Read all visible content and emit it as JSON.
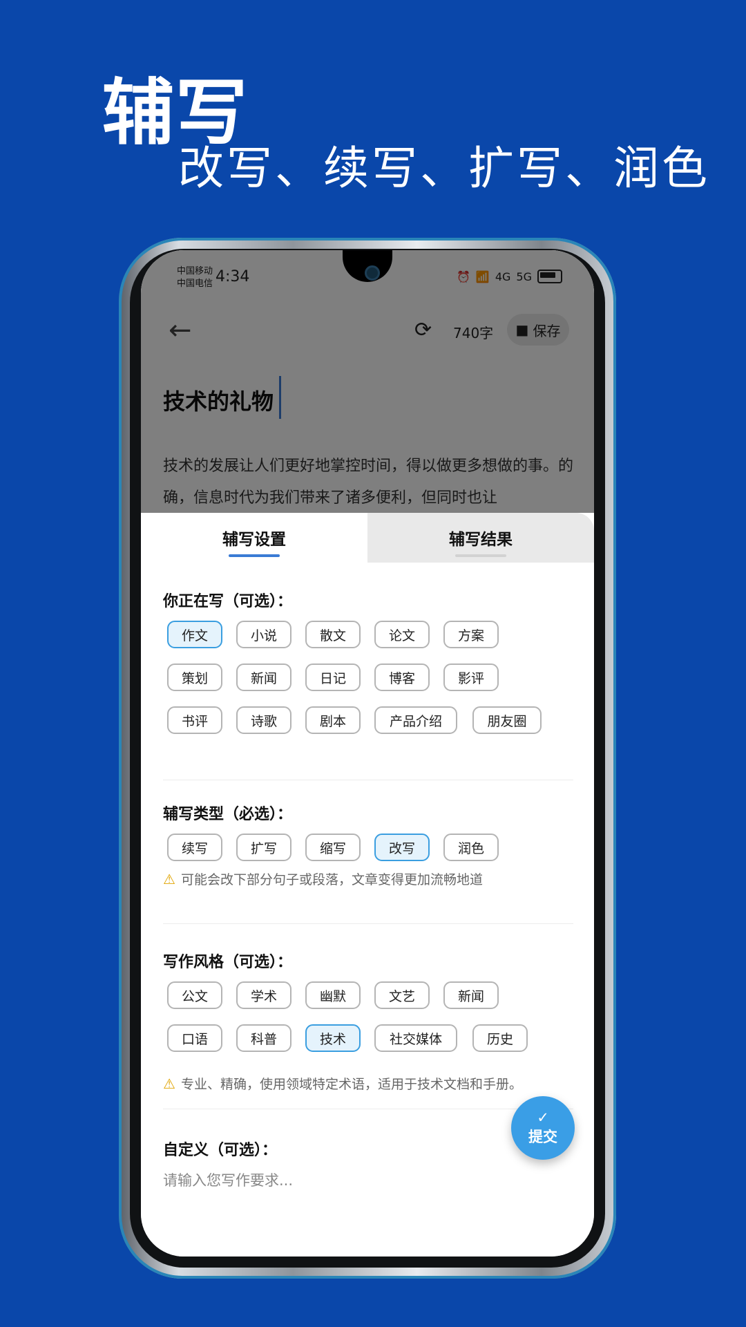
{
  "promo": {
    "headline": "辅写",
    "subline": "改写、续写、扩写、润色"
  },
  "status_bar": {
    "carrier1": "中国移动",
    "carrier2": "中国电信",
    "time": "4:34",
    "signal1": "4G",
    "signal2": "5G"
  },
  "toolbar": {
    "word_count": "740字",
    "save_label": "保存"
  },
  "document": {
    "title": "技术的礼物",
    "body": "技术的发展让人们更好地掌控时间，得以做更多想做的事。的确，信息时代为我们带来了诸多便利，但同时也让"
  },
  "tabs": [
    {
      "label": "辅写设置"
    },
    {
      "label": "辅写结果"
    }
  ],
  "sections": {
    "genre": {
      "title": "你正在写（可选）：",
      "chips": [
        "作文",
        "小说",
        "散文",
        "论文",
        "方案",
        "策划",
        "新闻",
        "日记",
        "博客",
        "影评",
        "书评",
        "诗歌",
        "剧本",
        "产品介绍",
        "朋友圈"
      ],
      "selected": "作文"
    },
    "type": {
      "title": "辅写类型（必选）：",
      "chips": [
        "续写",
        "扩写",
        "缩写",
        "改写",
        "润色"
      ],
      "selected": "改写",
      "hint": "可能会改下部分句子或段落，文章变得更加流畅地道"
    },
    "style": {
      "title": "写作风格（可选）：",
      "chips": [
        "公文",
        "学术",
        "幽默",
        "文艺",
        "新闻",
        "口语",
        "科普",
        "技术",
        "社交媒体",
        "历史"
      ],
      "selected": "技术",
      "hint": "专业、精确，使用领域特定术语，适用于技术文档和手册。"
    },
    "custom": {
      "title": "自定义（可选）：",
      "placeholder": "请输入您写作要求..."
    }
  },
  "fab": {
    "label": "提交"
  },
  "colors": {
    "background": "#0a47aa",
    "accent": "#3a9ee6",
    "warning": "#e0a400"
  }
}
